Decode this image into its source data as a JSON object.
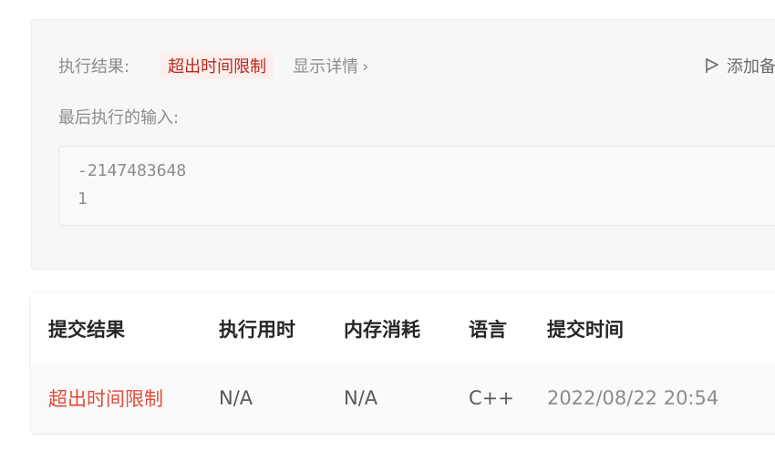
{
  "result": {
    "label": "执行结果:",
    "status": "超出时间限制",
    "details_link": "显示详情",
    "details_chevron": "›",
    "add_note": "添加备",
    "last_input_label": "最后执行的输入:",
    "input_lines": [
      "-2147483648",
      "1"
    ]
  },
  "table": {
    "headers": [
      "提交结果",
      "执行用时",
      "内存消耗",
      "语言",
      "提交时间"
    ],
    "rows": [
      [
        "超出时间限制",
        "N/A",
        "N/A",
        "C++",
        "2022/08/22 20:54"
      ]
    ]
  },
  "colors": {
    "status_red": "#e34b3c",
    "badge_bg": "#fdeeee",
    "badge_text": "#b52a1c"
  }
}
